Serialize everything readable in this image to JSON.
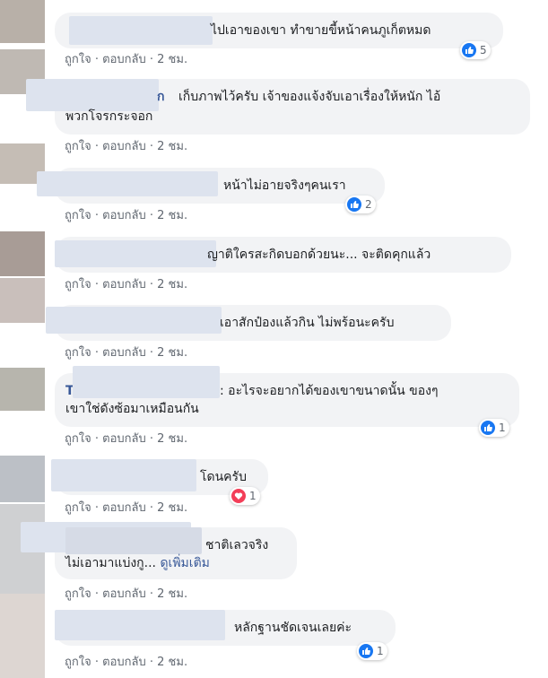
{
  "common": {
    "like": "ถูกใจ",
    "reply": "ตอบกลับ",
    "sep": "·",
    "time": "2 ชม."
  },
  "colors": {
    "like_blue": "#1877f2",
    "love_red": "#f33e58",
    "link": "#385898"
  },
  "comments": [
    {
      "text": "ไปเอาของเขา ทำขายขี้หน้าคนภูเก็ตหมด",
      "reaction": "like",
      "count": "5"
    },
    {
      "name_fragment": "ก",
      "text_line1": "เก็บภาพไว้ครับ เจ้าของแจ้งจับเอาเรื่องให้หนัก ไอ้",
      "text_line2": "พวกโจรกระจอก"
    },
    {
      "text": "หน้าไม่อายจริงๆคนเรา",
      "reaction": "like",
      "count": "2"
    },
    {
      "text": "ญาติใครสะกิดบอกด้วยนะ... จะติดคุกแล้ว"
    },
    {
      "text": "เอาสักป๋องแล้วกิน ไม่พร้อนะครับ"
    },
    {
      "name_fragment": "T",
      "text_line1": ": อะไรจะอยากได้ของเขาขนาดนั้น ของๆ",
      "text_line2": "เขาใช่ดังซ้อมาเหมือนกัน",
      "reaction": "like",
      "count": "1"
    },
    {
      "text": "โดนครับ",
      "reaction": "love",
      "count": "1"
    },
    {
      "text_line1": "ชาติเลวจริง",
      "text_line2": "ไม่เอามาแบ่งกู...",
      "see_more": "ดูเพิ่มเติม"
    },
    {
      "text": "หลักฐานชัดเจนเลยค่ะ",
      "reaction": "like",
      "count": "1"
    }
  ]
}
